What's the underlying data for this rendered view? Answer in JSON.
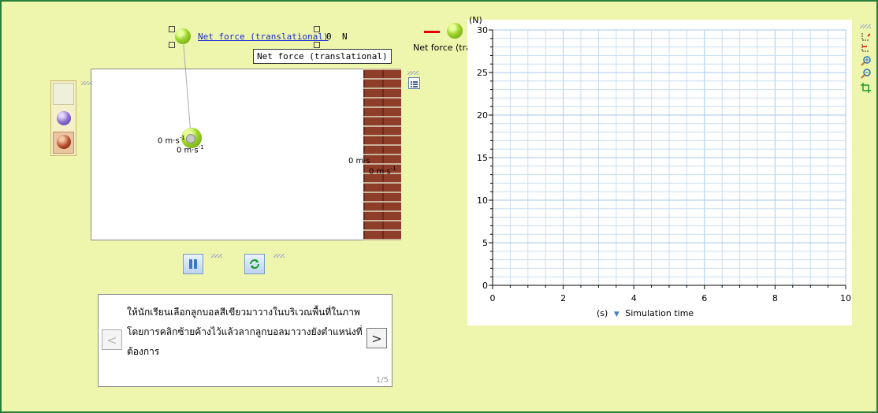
{
  "force_label": {
    "link_text": "Net force (translational)",
    "value": "0",
    "unit": "N",
    "tooltip": "Net force (translational)"
  },
  "scene": {
    "ball_velocity": "0 m·s",
    "ball_velocity_sup": "-1",
    "ball_velocity2": "0 m·s",
    "ball_velocity2_sup": "-1",
    "wall_velocity": "0 m·s",
    "wall_velocity2": "0 m·s",
    "wall_velocity2_sup": "-1"
  },
  "instructions": {
    "text": "ให้นักเรียนเลือกลูกบอลสีเขียวมาวางในบริเวณพื้นที่ในภาพ โดยการคลิกซ้ายค้างไว้แล้วลากลูกบอลมาวางยังตำแหน่งที่ต้องการ",
    "page": "1/5",
    "prev_label": "<",
    "next_label": ">"
  },
  "graph": {
    "legend_label": "Net force (tra...",
    "y_unit": "(N)",
    "x_unit": "(s)",
    "x_label": "Simulation time",
    "y_ticks": [
      "0",
      "5",
      "10",
      "15",
      "20",
      "25",
      "30"
    ],
    "x_ticks": [
      "0",
      "2",
      "4",
      "6",
      "8",
      "10"
    ],
    "series_color": "#e00000",
    "grid_color": "#c8def2"
  },
  "chart_data": {
    "type": "line",
    "title": "",
    "xlabel": "Simulation time",
    "ylabel": "(N)",
    "xlim": [
      0,
      10
    ],
    "ylim": [
      0,
      30
    ],
    "series": [
      {
        "name": "Net force (tra...",
        "x": [],
        "y": []
      }
    ],
    "grid": true
  },
  "icons": {
    "toolbar": [
      "zoom-box-icon",
      "zoom-box-icon",
      "zoom-in-icon",
      "zoom-out-icon",
      "crop-icon"
    ]
  }
}
